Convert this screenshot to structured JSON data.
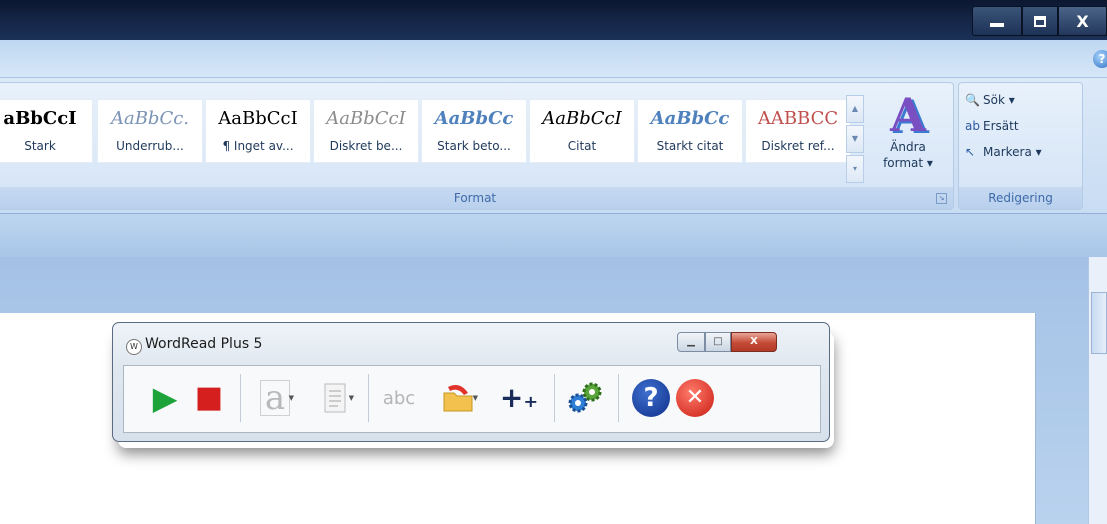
{
  "window": {
    "min_glyph": "",
    "close_glyph": "X"
  },
  "ribbon": {
    "help_glyph": "?",
    "format_group": {
      "label": "Format",
      "styles": [
        {
          "sample": "aBbCcI",
          "name": "Stark",
          "color": "#000000",
          "italic": false,
          "bold": true
        },
        {
          "sample": "AaBbCc.",
          "name": "Underrub...",
          "color": "#7b93b5",
          "italic": true,
          "bold": false
        },
        {
          "sample": "AaBbCcI",
          "name": "¶ Inget av...",
          "color": "#000000",
          "italic": false,
          "bold": false
        },
        {
          "sample": "AaBbCcI",
          "name": "Diskret be...",
          "color": "#8c8c8c",
          "italic": true,
          "bold": false
        },
        {
          "sample": "AaBbCc",
          "name": "Stark beto...",
          "color": "#4f81bd",
          "italic": true,
          "bold": true
        },
        {
          "sample": "AaBbCcI",
          "name": "Citat",
          "color": "#000000",
          "italic": true,
          "bold": false
        },
        {
          "sample": "AaBbCc",
          "name": "Starkt citat",
          "color": "#4f81bd",
          "italic": true,
          "bold": true
        },
        {
          "sample": "AABBCC",
          "name": "Diskret ref...",
          "color": "#c0504d",
          "italic": false,
          "bold": false
        }
      ],
      "change_format_line1": "Ändra",
      "change_format_line2": "format ▾",
      "big_a_glyph": "A"
    },
    "edit_group": {
      "label": "Redigering",
      "find_label": "Sök ▾",
      "replace_label": "Ersätt",
      "select_label": "Markera ▾"
    }
  },
  "wordread": {
    "title": "WordRead Plus 5",
    "app_icon_glyph": "W",
    "play_glyph": "▶",
    "stop_glyph": "■",
    "font_glyph": "a",
    "spell_glyph": "abc",
    "add_glyph": "+₊",
    "help_glyph": "?",
    "exit_glyph": "✕",
    "minimize_glyph": "▁",
    "maximize_glyph": "□",
    "close_glyph": "X"
  }
}
